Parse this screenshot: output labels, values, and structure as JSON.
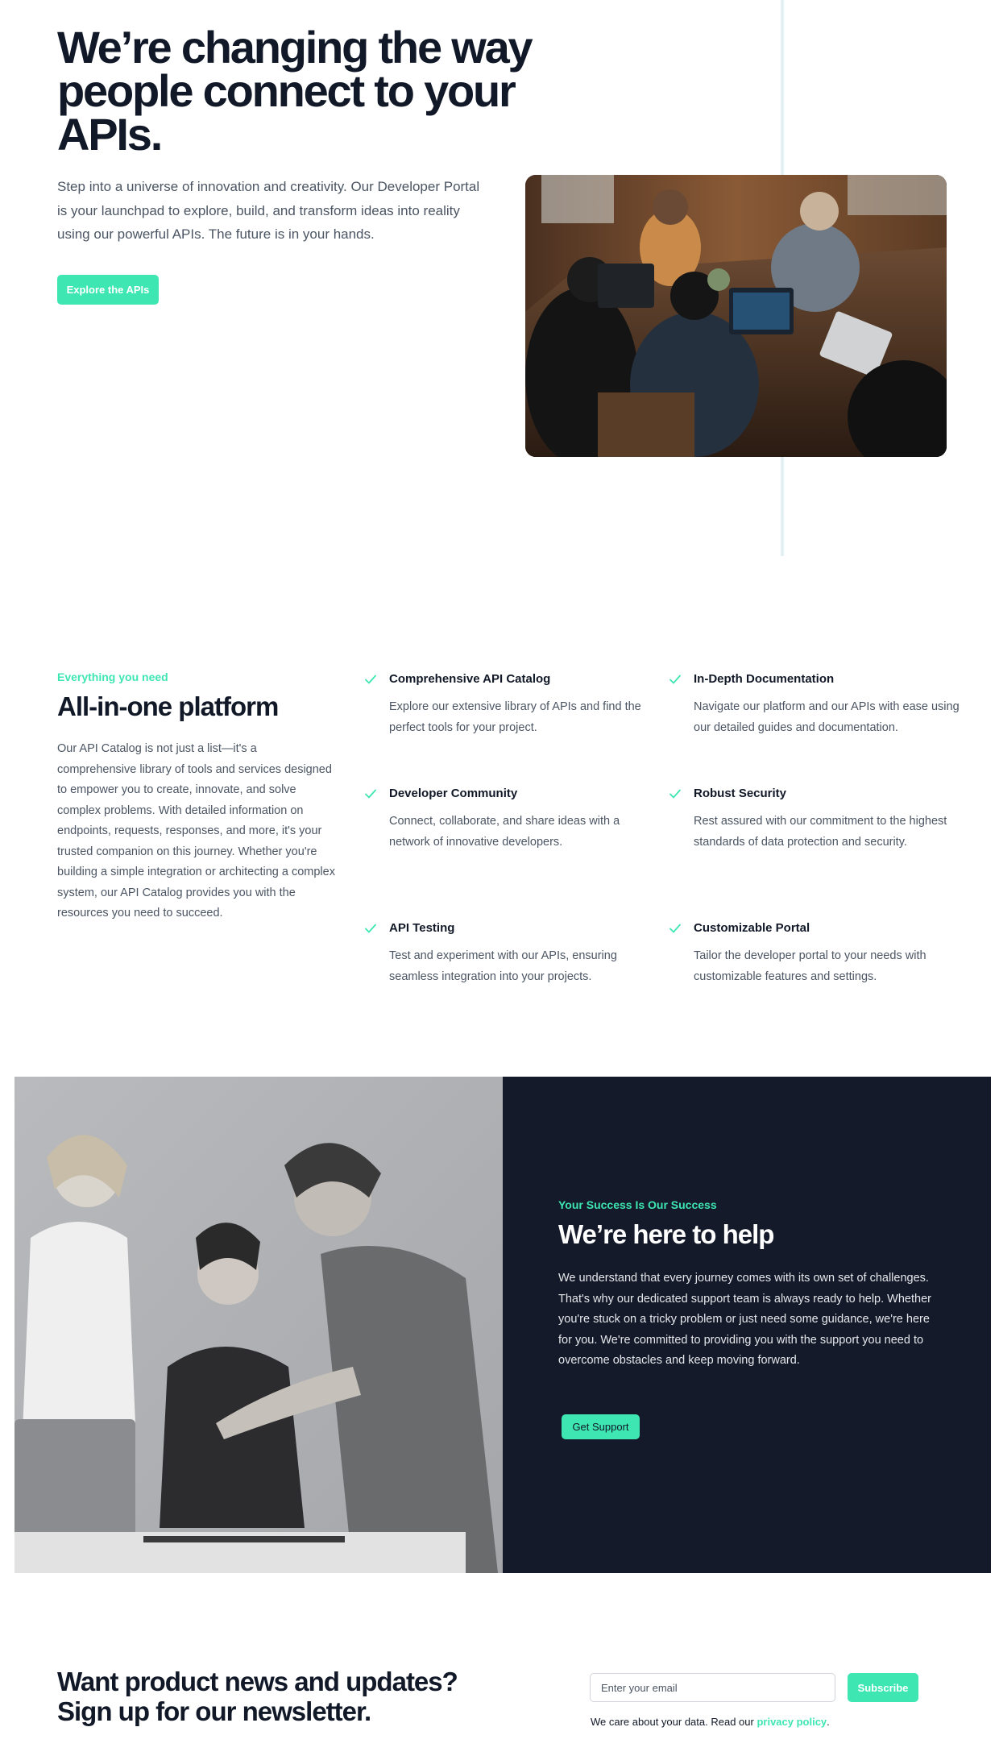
{
  "hero": {
    "title": "We’re changing the way people connect to your APIs.",
    "description": "Step into a universe of innovation and creativity. Our Developer Portal is your launchpad to explore, build, and transform ideas into reality using our powerful APIs. The future is in your hands.",
    "cta_label": "Explore the APIs"
  },
  "features": {
    "eyebrow": "Everything you need",
    "title": "All-in-one platform",
    "description": "Our API Catalog is not just a list—it's a comprehensive library of tools and services designed to empower you to create, innovate, and solve complex problems. With detailed information on endpoints, requests, responses, and more, it's your trusted companion on this journey. Whether you're building a simple integration or architecting a complex system, our API Catalog provides you with the resources you need to succeed.",
    "items": [
      {
        "name": "Comprehensive API Catalog",
        "text": "Explore our extensive library of APIs and find the perfect tools for your project."
      },
      {
        "name": "In-Depth Documentation",
        "text": "Navigate our platform and our APIs with ease using our detailed guides and documentation."
      },
      {
        "name": "Developer Community",
        "text": "Connect, collaborate, and share ideas with a network of innovative developers."
      },
      {
        "name": "Robust Security",
        "text": "Rest assured with our commitment to the highest standards of data protection and security."
      },
      {
        "name": "API Testing",
        "text": "Test and experiment with our APIs, ensuring seamless integration into your projects."
      },
      {
        "name": "Customizable Portal",
        "text": "Tailor the developer portal to your needs with customizable features and settings."
      }
    ]
  },
  "support": {
    "eyebrow": "Your Success Is Our Success",
    "title": "We’re here to help",
    "description": "We understand that every journey comes with its own set of challenges. That's why our dedicated support team is always ready to help. Whether you're stuck on a tricky problem or just need some guidance, we're here for you. We're committed to providing you with the support you need to overcome obstacles and keep moving forward.",
    "cta_label": "Get Support"
  },
  "newsletter": {
    "title": "Want product news and updates? Sign up for our newsletter.",
    "email_placeholder": "Enter your email",
    "email_value": "",
    "subscribe_label": "Subscribe",
    "note_prefix": "We care about your data. Read our ",
    "privacy_link": "privacy policy",
    "note_suffix": "."
  },
  "colors": {
    "accent": "#3ee6b2",
    "dark_panel": "#141a2a",
    "heading": "#111827",
    "body_text": "#4b5563"
  },
  "icons": {
    "feature_check": "check-icon"
  }
}
